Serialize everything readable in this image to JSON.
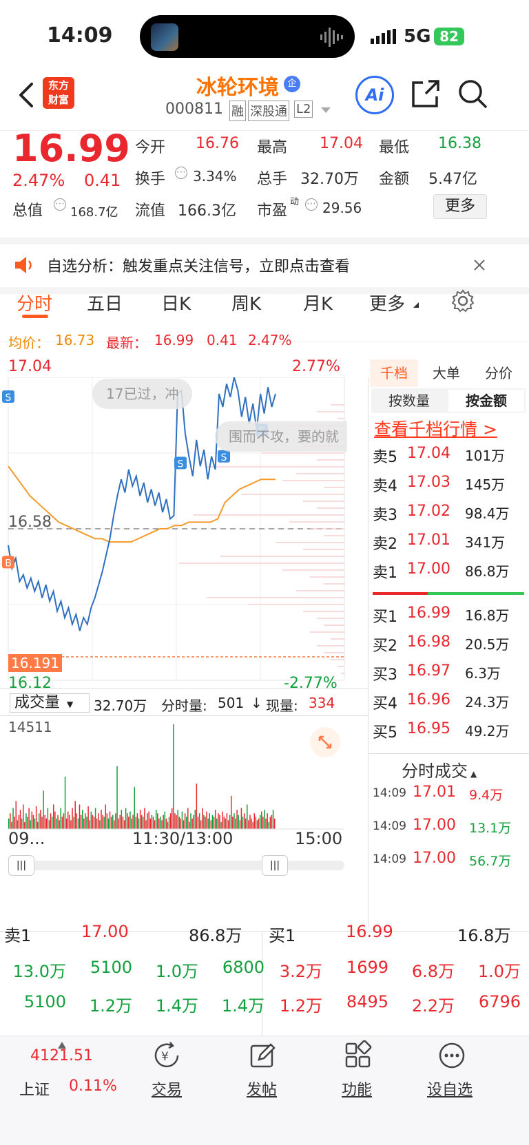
{
  "status_bar": {
    "time": "14:09",
    "network": "5G",
    "battery": "82"
  },
  "header": {
    "logo_line1": "东方",
    "logo_line2": "财富",
    "stock_name": "冰轮环境",
    "badge": "企",
    "code": "000811",
    "tags": [
      "融",
      "深股通",
      "L2"
    ],
    "ai_label": "Ai"
  },
  "quote": {
    "price": "16.99",
    "change_pct": "2.47%",
    "change": "0.41",
    "total_value_label": "总值",
    "total_value": "168.7亿",
    "open_label": "今开",
    "open": "16.76",
    "high_label": "最高",
    "high": "17.04",
    "low_label": "最低",
    "low": "16.38",
    "turnover_label": "换手",
    "turnover": "3.34%",
    "volume_label": "总手",
    "volume": "32.70万",
    "amount_label": "金额",
    "amount": "5.47亿",
    "float_label": "流值",
    "float_value": "166.3亿",
    "pe_label": "市盈",
    "pe_sup": "动",
    "pe": "29.56",
    "more_button": "更多"
  },
  "notice": {
    "text": "自选分析：触发重点关注信号，立即点击查看"
  },
  "tabs": [
    "分时",
    "五日",
    "日K",
    "周K",
    "月K",
    "更多"
  ],
  "active_tab": 0,
  "chart_info": {
    "avg_label": "均价：",
    "avg": "16.73",
    "last_label": "最新：",
    "last": "16.99",
    "change": "0.41",
    "change_pct": "2.47%"
  },
  "chart_data": {
    "type": "line",
    "ylim": [
      16.12,
      17.04
    ],
    "y_labels_left": [
      "17.04",
      "16.58",
      "16.12"
    ],
    "y_labels_right": [
      "2.77%",
      "-2.77%"
    ],
    "reference_price": "16.58",
    "marker_price": "16.191",
    "x_labels": [
      "09...",
      "11:30/13:00",
      "15:00"
    ],
    "price_series": [
      16.53,
      16.46,
      16.49,
      16.42,
      16.44,
      16.4,
      16.43,
      16.39,
      16.42,
      16.37,
      16.41,
      16.36,
      16.39,
      16.33,
      16.36,
      16.31,
      16.34,
      16.29,
      16.32,
      16.27,
      16.31,
      16.29,
      16.34,
      16.37,
      16.41,
      16.45,
      16.5,
      16.55,
      16.62,
      16.68,
      16.73,
      16.69,
      16.76,
      16.71,
      16.74,
      16.68,
      16.72,
      16.66,
      16.7,
      16.65,
      16.69,
      16.63,
      16.67,
      16.61,
      16.62,
      16.99,
      17.0,
      16.87,
      16.8,
      16.74,
      16.85,
      16.77,
      16.82,
      16.73,
      16.8,
      16.76,
      16.99,
      16.95,
      17.02,
      16.98,
      17.04,
      17.0,
      16.92,
      16.98,
      16.9,
      16.96,
      16.88,
      16.99,
      16.93,
      17.01,
      16.95,
      16.99
    ],
    "avg_series": [
      16.77,
      16.74,
      16.71,
      16.68,
      16.66,
      16.64,
      16.62,
      16.6,
      16.59,
      16.58,
      16.57,
      16.56,
      16.55,
      16.55,
      16.54,
      16.54,
      16.54,
      16.54,
      16.55,
      16.56,
      16.57,
      16.58,
      16.58,
      16.59,
      16.59,
      16.6,
      16.6,
      16.6,
      16.6,
      16.61,
      16.66,
      16.68,
      16.7,
      16.71,
      16.72,
      16.73,
      16.73,
      16.73
    ],
    "volume_max_label": "14511",
    "volume_label": "成交量",
    "volume_total": "32.70万",
    "tick_volume_label": "分时量:",
    "tick_volume": "501",
    "current_volume_label": "现量:",
    "current_volume": "334",
    "volumes": [
      30,
      45,
      20,
      60,
      35,
      80,
      25,
      40,
      55,
      30,
      70,
      20,
      45,
      35,
      60,
      25,
      50,
      40,
      30,
      65,
      20,
      45,
      55,
      35,
      110,
      40,
      30,
      60,
      25,
      45,
      35,
      70,
      50,
      30,
      40,
      25,
      60,
      35,
      45,
      150,
      30,
      50,
      40,
      25,
      60,
      35,
      80,
      45,
      30,
      70,
      40,
      55,
      30,
      45,
      35,
      65,
      25,
      50,
      40,
      35,
      60,
      30,
      45,
      25,
      55,
      40,
      35,
      70,
      45,
      30,
      50,
      35,
      40,
      25,
      45,
      180,
      30,
      40,
      55,
      35,
      25,
      60,
      45,
      35,
      50,
      30,
      40,
      120,
      35,
      45,
      30,
      55,
      40,
      35,
      60,
      25,
      45,
      50,
      30,
      40,
      35,
      25,
      55,
      45,
      30,
      35,
      25,
      40,
      50,
      30,
      20,
      35,
      45,
      60,
      300,
      45,
      40,
      55,
      35,
      30,
      50,
      25,
      45,
      35,
      60,
      20,
      45,
      30,
      40,
      55,
      130,
      35,
      45,
      25,
      60,
      40,
      35,
      50,
      30,
      45,
      25,
      40,
      35,
      55,
      30,
      45,
      40,
      20,
      50,
      35,
      30,
      45,
      25,
      40,
      95,
      35,
      45,
      30,
      55,
      40,
      25,
      60,
      35,
      45,
      30,
      70,
      25,
      40,
      30,
      20,
      45,
      35,
      25,
      30,
      40,
      50,
      35,
      55,
      30,
      45,
      20,
      35,
      40,
      55,
      30
    ]
  },
  "side": {
    "tabs": [
      "千档",
      "大单",
      "分价"
    ],
    "sub_tabs": [
      "按数量",
      "按金额"
    ],
    "link": "查看千档行情 >",
    "sell": [
      {
        "label": "卖5",
        "price": "17.04",
        "amount": "101万"
      },
      {
        "label": "卖4",
        "price": "17.03",
        "amount": "145万"
      },
      {
        "label": "卖3",
        "price": "17.02",
        "amount": "98.4万"
      },
      {
        "label": "卖2",
        "price": "17.01",
        "amount": "341万"
      },
      {
        "label": "卖1",
        "price": "17.00",
        "amount": "86.8万"
      }
    ],
    "buy": [
      {
        "label": "买1",
        "price": "16.99",
        "amount": "16.8万"
      },
      {
        "label": "买2",
        "price": "16.98",
        "amount": "20.5万"
      },
      {
        "label": "买3",
        "price": "16.97",
        "amount": "6.3万"
      },
      {
        "label": "买4",
        "price": "16.96",
        "amount": "24.3万"
      },
      {
        "label": "买5",
        "price": "16.95",
        "amount": "49.2万"
      }
    ],
    "trades_title": "分时成交",
    "trades": [
      {
        "time": "14:09",
        "price": "17.01",
        "amount": "9.4万"
      },
      {
        "time": "14:09",
        "price": "17.00",
        "amount": "13.1万"
      },
      {
        "time": "14:09",
        "price": "17.00",
        "amount": "56.7万"
      }
    ]
  },
  "bottom": {
    "sell_label": "卖1",
    "sell_price": "17.00",
    "sell_amount": "86.8万",
    "buy_label": "买1",
    "buy_price": "16.99",
    "buy_amount": "16.8万",
    "sell_queue_row1": [
      "13.0万",
      "5100",
      "1.0万",
      "6800"
    ],
    "sell_queue_row2": [
      "5100",
      "1.2万",
      "1.4万",
      "1.4万"
    ],
    "buy_queue_row1": [
      "3.2万",
      "1699",
      "6.8万",
      "1.0万"
    ],
    "buy_queue_row2": [
      "1.2万",
      "8495",
      "2.2万",
      "6796"
    ]
  },
  "nav": {
    "index_value": "4121.51",
    "index_name": "上证",
    "index_change": "0.11%",
    "items": [
      "交易",
      "发帖",
      "功能",
      "设自选"
    ]
  },
  "overlays": {
    "bubble1": "17已过，冲",
    "bubble2": "围而不攻，要的就"
  }
}
